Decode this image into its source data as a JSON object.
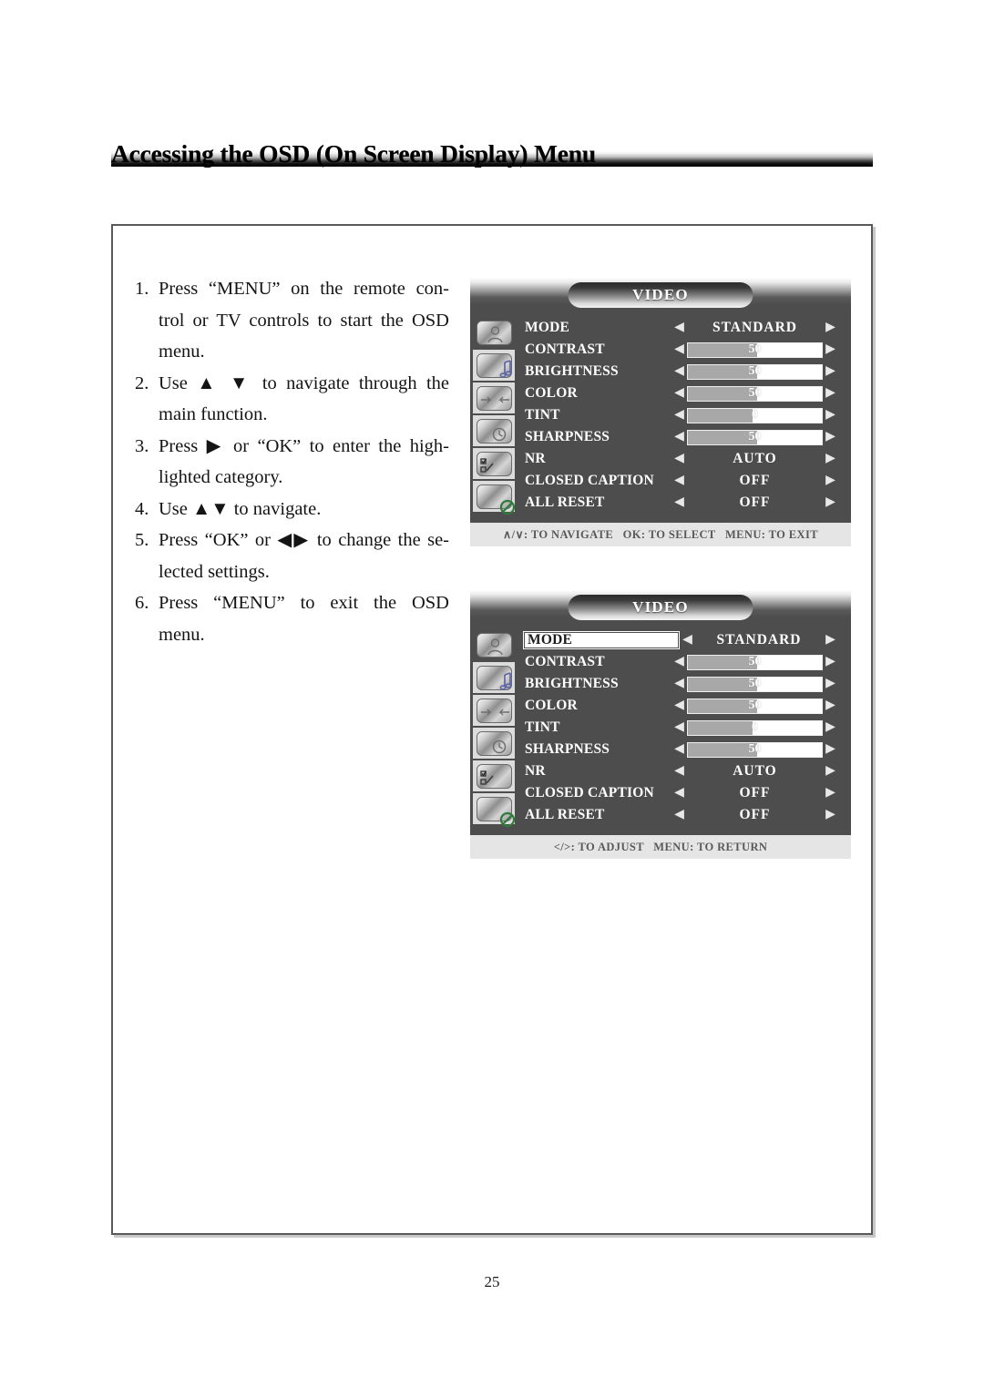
{
  "header": {
    "title": "Accessing the OSD (On Screen Display) Menu"
  },
  "instructions": [
    {
      "num": "1.",
      "line1": "Press “MENU” on the remote con-",
      "line2": "trol or TV controls to start the  OSD",
      "line3": "menu."
    },
    {
      "num": "2.",
      "line1": "Use ▲ ▼ to navigate through the",
      "line2": "main function.",
      "line3": ""
    },
    {
      "num": "3.",
      "line1": "Press ▶ or “OK” to enter the high-",
      "line2": "lighted category.",
      "line3": ""
    },
    {
      "num": "4.",
      "line1": "Use ▲▼ to navigate.",
      "line2": "",
      "line3": ""
    },
    {
      "num": "5.",
      "line1": "Press “OK” or  ◀▶ to change the se-",
      "line2": "lected settings.",
      "line3": ""
    },
    {
      "num": "6.",
      "line1": "Press “MENU” to exit the OSD",
      "line2": "menu.",
      "line3": ""
    }
  ],
  "osd": {
    "title": "VIDEO",
    "left_caret": "◀",
    "right_caret": "▶",
    "sidebar_icons": [
      {
        "name": "picture-icon",
        "selected": true
      },
      {
        "name": "audio-icon",
        "selected": false
      },
      {
        "name": "channel-icon",
        "selected": false
      },
      {
        "name": "timer-icon",
        "selected": false
      },
      {
        "name": "setup-icon",
        "selected": false
      },
      {
        "name": "lock-icon",
        "selected": false
      }
    ],
    "rows": [
      {
        "label": "MODE",
        "kind": "value",
        "value": "STANDARD"
      },
      {
        "label": "CONTRAST",
        "kind": "slider",
        "value": "50",
        "fill": 52
      },
      {
        "label": "BRIGHTNESS",
        "kind": "slider",
        "value": "50",
        "fill": 52
      },
      {
        "label": "COLOR",
        "kind": "slider",
        "value": "50",
        "fill": 52
      },
      {
        "label": "TINT",
        "kind": "slider",
        "value": "0",
        "fill": 48
      },
      {
        "label": "SHARPNESS",
        "kind": "slider",
        "value": "50",
        "fill": 52
      },
      {
        "label": "NR",
        "kind": "value",
        "value": "AUTO"
      },
      {
        "label": "CLOSED CAPTION",
        "kind": "value",
        "value": "OFF"
      },
      {
        "label": "ALL RESET",
        "kind": "value",
        "value": "OFF"
      }
    ],
    "panel1": {
      "footer": "∧/∨: TO NAVIGATE   OK: TO SELECT   MENU: TO EXIT",
      "highlighted_row": null
    },
    "panel2": {
      "footer": "</>: TO ADJUST   MENU: TO RETURN",
      "highlighted_row": "MODE"
    }
  },
  "page_number": "25",
  "colors": {
    "panel_bg": "#4d4d4d",
    "footer_bg": "#e5e5e5",
    "footer_text": "#595959",
    "slider_fill": "#a8a8a8",
    "slider_track": "#ffffff",
    "frame_border": "#58595b"
  }
}
